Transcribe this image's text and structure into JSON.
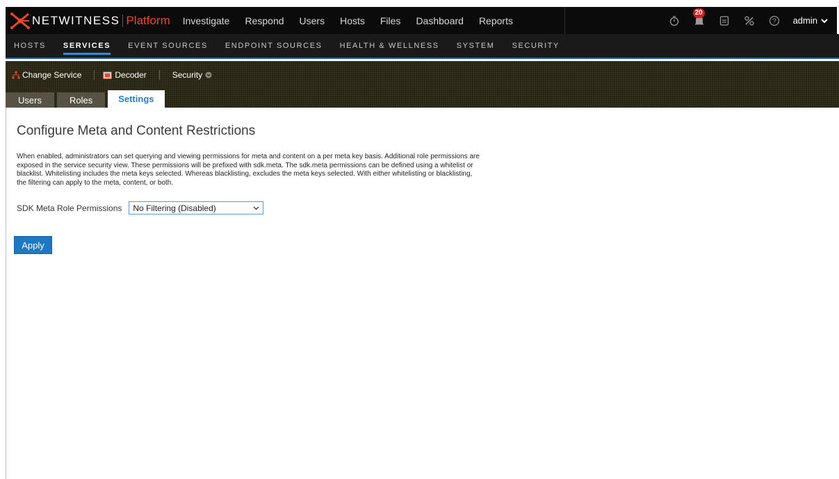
{
  "brand": {
    "name": "NETWITNESS",
    "product": "Platform",
    "accent_color": "#e8472d"
  },
  "top_nav": {
    "items": [
      "Investigate",
      "Respond",
      "Users",
      "Hosts",
      "Files",
      "Dashboard",
      "Reports"
    ]
  },
  "top_right": {
    "timer_icon": "stopwatch-icon",
    "notification_count": "20",
    "tasks_icon": "clipboard-icon",
    "tools_icon": "wrench-icon",
    "help_icon": "help-icon",
    "user": "admin"
  },
  "sub_nav": {
    "items": [
      "HOSTS",
      "SERVICES",
      "EVENT SOURCES",
      "ENDPOINT SOURCES",
      "HEALTH & WELLNESS",
      "SYSTEM",
      "SECURITY"
    ],
    "active": "SERVICES"
  },
  "service_bar": {
    "change_service": "Change Service",
    "service_name": "Decoder",
    "view": "Security"
  },
  "tabs": {
    "items": [
      "Users",
      "Roles",
      "Settings"
    ],
    "active": "Settings"
  },
  "main": {
    "title": "Configure Meta and Content Restrictions",
    "description": "When enabled, administrators can set querying and viewing permissions for meta and content on a per meta key basis. Additional role permissions are exposed in the service security view. These permissions will be prefixed with sdk.meta. The sdk.meta permissions can be defined using a whitelist or blacklist. Whitelisting includes the meta keys selected. Whereas blacklisting, excludes the meta keys selected. With either whitelisting or blacklisting, the filtering can apply to the meta, content, or both.",
    "permissions_label": "SDK Meta Role Permissions",
    "permissions_value": "No Filtering (Disabled)",
    "apply_label": "Apply"
  }
}
